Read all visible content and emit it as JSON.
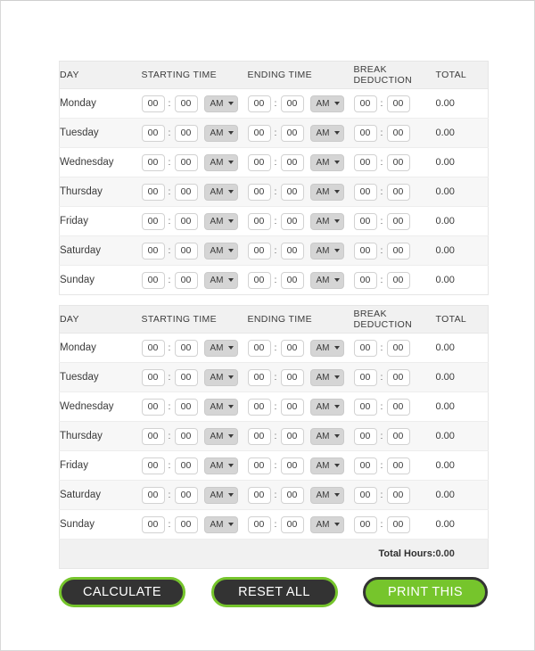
{
  "table": {
    "columns": [
      {
        "key": "day",
        "label": "DAY"
      },
      {
        "key": "start",
        "label": "STARTING TIME"
      },
      {
        "key": "end",
        "label": "ENDING TIME"
      },
      {
        "key": "break",
        "label": "BREAK DEDUCTION"
      },
      {
        "key": "total",
        "label": "TOTAL"
      }
    ],
    "time_defaults": {
      "hours": "00",
      "minutes": "00",
      "separator": ":",
      "meridiem": "AM",
      "total": "0.00"
    },
    "meridiem_options": [
      "AM",
      "PM"
    ],
    "weeks": [
      {
        "rows": [
          {
            "day": "Monday",
            "start_h": "00",
            "start_m": "00",
            "start_ampm": "AM",
            "end_h": "00",
            "end_m": "00",
            "end_ampm": "AM",
            "break_h": "00",
            "break_m": "00",
            "total": "0.00"
          },
          {
            "day": "Tuesday",
            "start_h": "00",
            "start_m": "00",
            "start_ampm": "AM",
            "end_h": "00",
            "end_m": "00",
            "end_ampm": "AM",
            "break_h": "00",
            "break_m": "00",
            "total": "0.00"
          },
          {
            "day": "Wednesday",
            "start_h": "00",
            "start_m": "00",
            "start_ampm": "AM",
            "end_h": "00",
            "end_m": "00",
            "end_ampm": "AM",
            "break_h": "00",
            "break_m": "00",
            "total": "0.00"
          },
          {
            "day": "Thursday",
            "start_h": "00",
            "start_m": "00",
            "start_ampm": "AM",
            "end_h": "00",
            "end_m": "00",
            "end_ampm": "AM",
            "break_h": "00",
            "break_m": "00",
            "total": "0.00"
          },
          {
            "day": "Friday",
            "start_h": "00",
            "start_m": "00",
            "start_ampm": "AM",
            "end_h": "00",
            "end_m": "00",
            "end_ampm": "AM",
            "break_h": "00",
            "break_m": "00",
            "total": "0.00"
          },
          {
            "day": "Saturday",
            "start_h": "00",
            "start_m": "00",
            "start_ampm": "AM",
            "end_h": "00",
            "end_m": "00",
            "end_ampm": "AM",
            "break_h": "00",
            "break_m": "00",
            "total": "0.00"
          },
          {
            "day": "Sunday",
            "start_h": "00",
            "start_m": "00",
            "start_ampm": "AM",
            "end_h": "00",
            "end_m": "00",
            "end_ampm": "AM",
            "break_h": "00",
            "break_m": "00",
            "total": "0.00"
          }
        ],
        "has_total_row": false
      },
      {
        "rows": [
          {
            "day": "Monday",
            "start_h": "00",
            "start_m": "00",
            "start_ampm": "AM",
            "end_h": "00",
            "end_m": "00",
            "end_ampm": "AM",
            "break_h": "00",
            "break_m": "00",
            "total": "0.00"
          },
          {
            "day": "Tuesday",
            "start_h": "00",
            "start_m": "00",
            "start_ampm": "AM",
            "end_h": "00",
            "end_m": "00",
            "end_ampm": "AM",
            "break_h": "00",
            "break_m": "00",
            "total": "0.00"
          },
          {
            "day": "Wednesday",
            "start_h": "00",
            "start_m": "00",
            "start_ampm": "AM",
            "end_h": "00",
            "end_m": "00",
            "end_ampm": "AM",
            "break_h": "00",
            "break_m": "00",
            "total": "0.00"
          },
          {
            "day": "Thursday",
            "start_h": "00",
            "start_m": "00",
            "start_ampm": "AM",
            "end_h": "00",
            "end_m": "00",
            "end_ampm": "AM",
            "break_h": "00",
            "break_m": "00",
            "total": "0.00"
          },
          {
            "day": "Friday",
            "start_h": "00",
            "start_m": "00",
            "start_ampm": "AM",
            "end_h": "00",
            "end_m": "00",
            "end_ampm": "AM",
            "break_h": "00",
            "break_m": "00",
            "total": "0.00"
          },
          {
            "day": "Saturday",
            "start_h": "00",
            "start_m": "00",
            "start_ampm": "AM",
            "end_h": "00",
            "end_m": "00",
            "end_ampm": "AM",
            "break_h": "00",
            "break_m": "00",
            "total": "0.00"
          },
          {
            "day": "Sunday",
            "start_h": "00",
            "start_m": "00",
            "start_ampm": "AM",
            "end_h": "00",
            "end_m": "00",
            "end_ampm": "AM",
            "break_h": "00",
            "break_m": "00",
            "total": "0.00"
          }
        ],
        "has_total_row": true
      }
    ],
    "footer": {
      "total_hours_label": "Total Hours:",
      "total_hours_value": "0.00"
    }
  },
  "buttons": [
    {
      "id": "calculate",
      "label": "CALCULATE",
      "style": "dark",
      "width_class": "w-calc"
    },
    {
      "id": "reset",
      "label": "RESET ALL",
      "style": "dark",
      "width_class": "w-reset"
    },
    {
      "id": "print",
      "label": "PRINT THIS",
      "style": "green",
      "width_class": "w-print"
    }
  ],
  "colors": {
    "accent_green": "#76c52c",
    "dark_button": "#333333",
    "header_bg": "#f1f1f1",
    "row_alt_bg": "#f7f7f7",
    "border": "#e6e6e6"
  }
}
